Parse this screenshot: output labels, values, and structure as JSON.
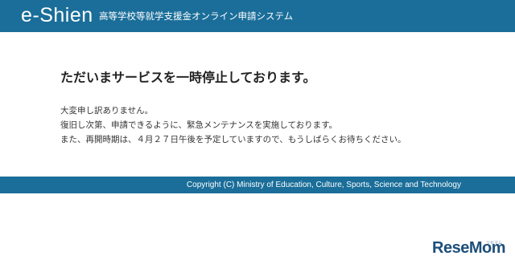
{
  "header": {
    "brand": "e-Shien",
    "system_name": "高等学校等就学支援金オンライン申請システム"
  },
  "main": {
    "headline": "ただいまサービスを一時停止しております。",
    "messages": [
      "大変申し訳ありません。",
      "復旧し次第、申請できるように、緊急メンテナンスを実施しております。",
      "また、再開時期は、４月２７日午後を予定していますので、もうしばらくお待ちください。"
    ]
  },
  "footer": {
    "copyright": "Copyright (C) Ministry of Education, Culture, Sports, Science and Technology"
  },
  "watermark": {
    "text": "ReseMom",
    "ruby": "リセマム"
  },
  "colors": {
    "header_bg": "#1a6e99",
    "footer_bg": "#1a6e99",
    "watermark": "#1d4f7a"
  }
}
